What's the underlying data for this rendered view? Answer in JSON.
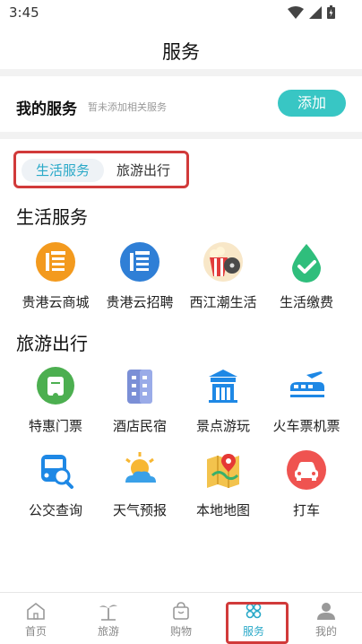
{
  "status": {
    "time": "3:45"
  },
  "header": {
    "title": "服务"
  },
  "my_services": {
    "label": "我的服务",
    "hint": "暂未添加相关服务",
    "add_label": "添加"
  },
  "tabs": [
    {
      "label": "生活服务",
      "active": true
    },
    {
      "label": "旅游出行",
      "active": false
    }
  ],
  "life": {
    "title": "生活服务",
    "items": [
      {
        "name": "贵港云商城",
        "icon": "guigang-mall-icon"
      },
      {
        "name": "贵港云招聘",
        "icon": "guigang-recruit-icon"
      },
      {
        "name": "西江潮生活",
        "icon": "popcorn-film-icon"
      },
      {
        "name": "生活缴费",
        "icon": "payment-drop-icon"
      }
    ]
  },
  "travel": {
    "title": "旅游出行",
    "items": [
      {
        "name": "特惠门票",
        "icon": "ticket-icon"
      },
      {
        "name": "酒店民宿",
        "icon": "hotel-icon"
      },
      {
        "name": "景点游玩",
        "icon": "attraction-icon"
      },
      {
        "name": "火车票机票",
        "icon": "train-plane-icon"
      },
      {
        "name": "公交查询",
        "icon": "bus-search-icon"
      },
      {
        "name": "天气预报",
        "icon": "weather-icon"
      },
      {
        "name": "本地地图",
        "icon": "map-icon"
      },
      {
        "name": "打车",
        "icon": "taxi-icon"
      }
    ]
  },
  "nav": [
    {
      "label": "首页",
      "icon": "home-icon",
      "active": false
    },
    {
      "label": "旅游",
      "icon": "palm-tree-icon",
      "active": false
    },
    {
      "label": "购物",
      "icon": "shopping-bag-icon",
      "active": false
    },
    {
      "label": "服务",
      "icon": "service-icon",
      "active": true
    },
    {
      "label": "我的",
      "icon": "user-icon",
      "active": false
    }
  ],
  "colors": {
    "accent": "#2aa9c8",
    "add_button": "#38c6c4",
    "highlight": "#d13a3a"
  }
}
